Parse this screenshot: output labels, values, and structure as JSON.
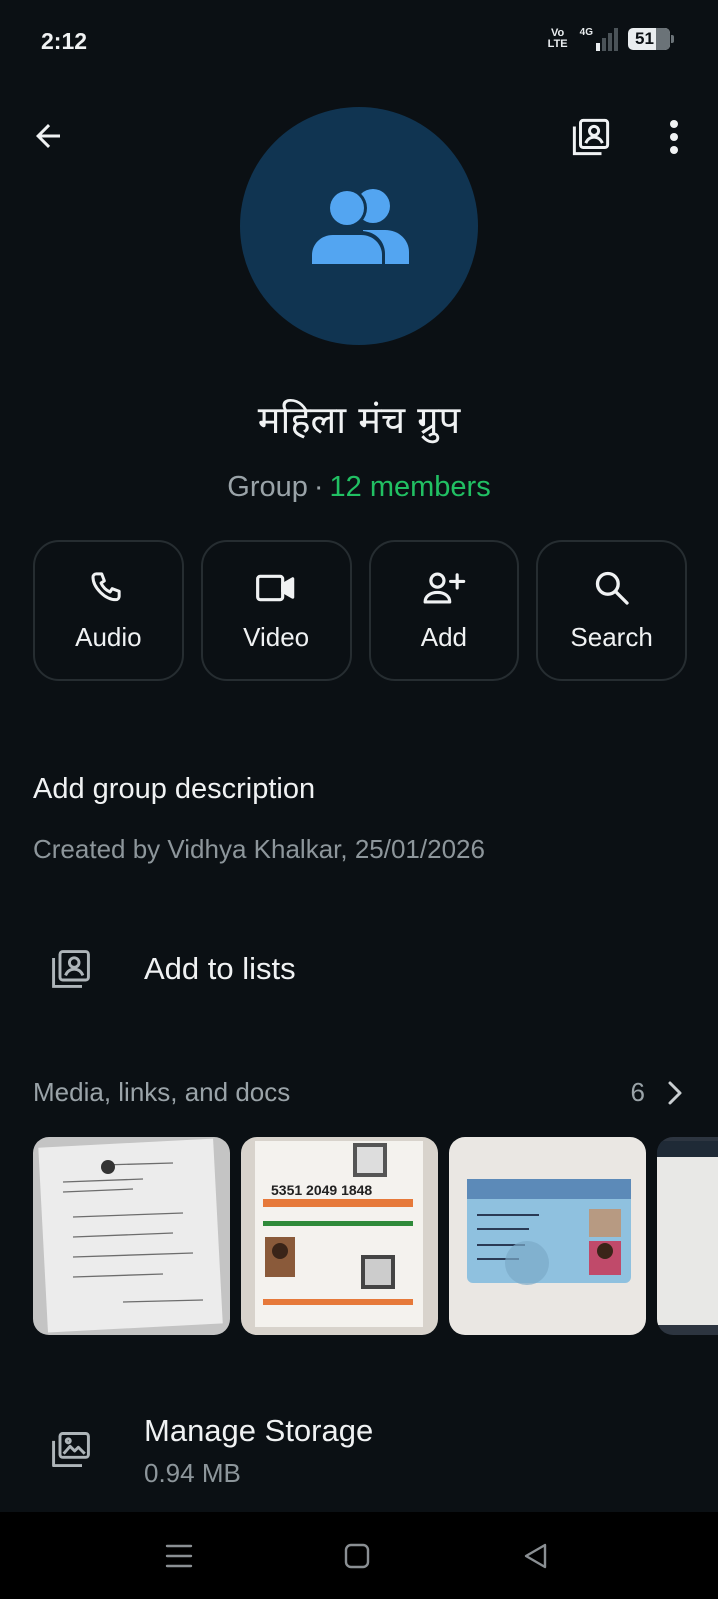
{
  "status": {
    "time": "2:12",
    "volte_top": "Vo",
    "volte_bottom": "LTE",
    "network": "4G",
    "battery": "51"
  },
  "header": {
    "back_icon": "arrow-left-icon",
    "lists_icon": "contact-list-icon",
    "menu_icon": "more-vertical-icon"
  },
  "group": {
    "avatar_icon": "group-icon",
    "name": "महिला मंच ग्रुप",
    "kind": "Group",
    "separator": "·",
    "members": "12 members"
  },
  "actions": [
    {
      "label": "Audio",
      "icon": "phone-icon"
    },
    {
      "label": "Video",
      "icon": "video-camera-icon"
    },
    {
      "label": "Add",
      "icon": "add-person-icon"
    },
    {
      "label": "Search",
      "icon": "search-icon"
    }
  ],
  "description": {
    "title": "Add group description",
    "created": "Created by Vidhya Khalkar, 25/01/2026"
  },
  "lists_row": {
    "label": "Add to lists",
    "icon": "contact-list-icon"
  },
  "media": {
    "title": "Media, links, and docs",
    "count": "6",
    "thumbnails": [
      {
        "card_number": ""
      },
      {
        "card_number": "5351 2049 1848"
      },
      {
        "card_number": ""
      },
      {
        "card_number": ""
      }
    ]
  },
  "storage": {
    "label": "Manage Storage",
    "size": "0.94 MB",
    "icon": "storage-icon"
  },
  "nav": {
    "menu_icon": "recents-icon",
    "home_icon": "home-icon",
    "back_icon": "back-triangle-icon"
  },
  "colors": {
    "background": "#0b1014",
    "accent_green": "#21c063",
    "avatar_bg": "#103451",
    "avatar_icon": "#53a5f1"
  }
}
